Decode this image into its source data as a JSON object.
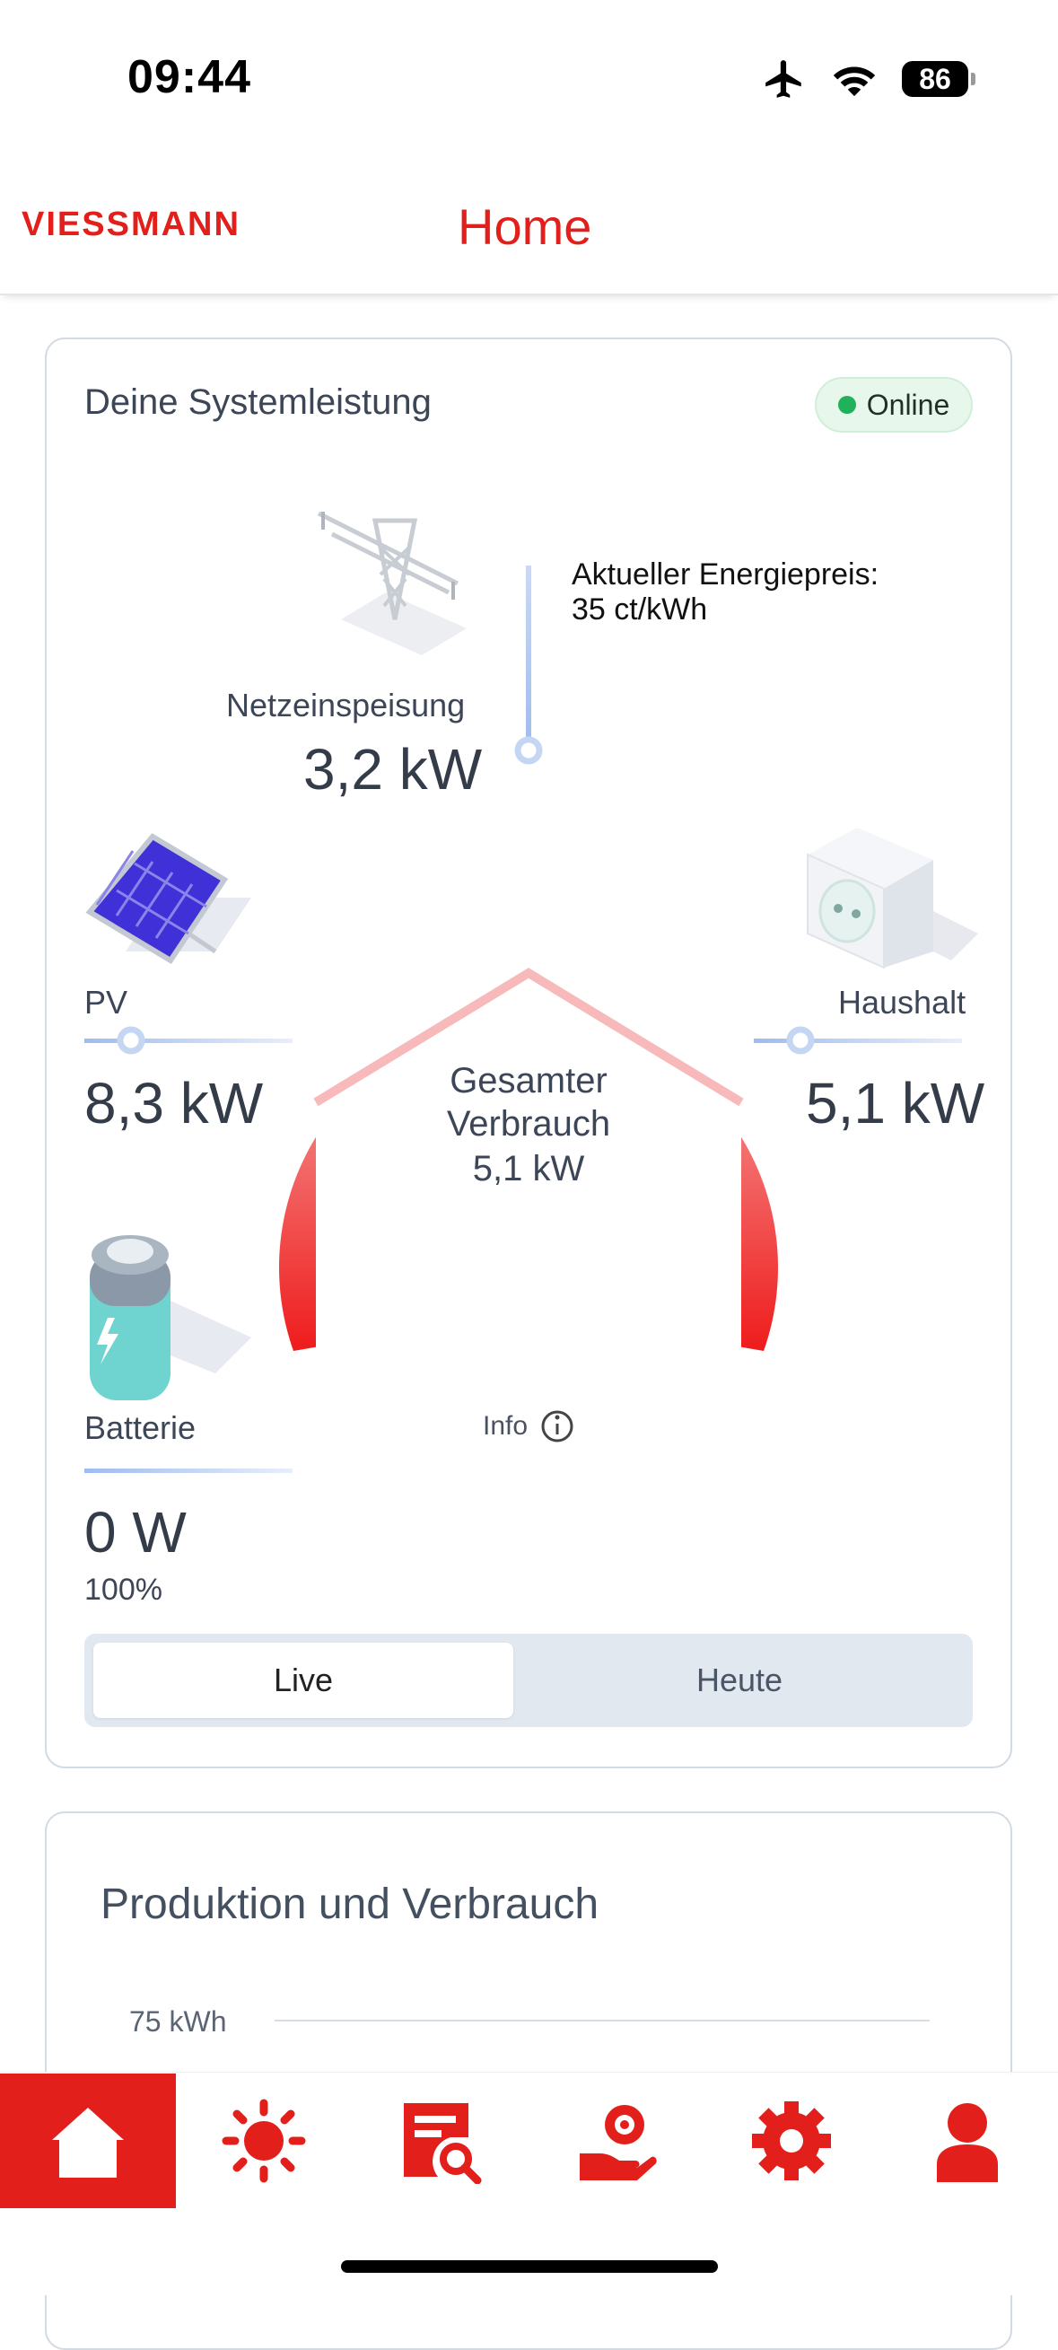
{
  "status": {
    "time": "09:44",
    "battery": "86"
  },
  "header": {
    "brand": "VIESSMANN",
    "title": "Home"
  },
  "system": {
    "title": "Deine Systemleistung",
    "status_badge": "Online",
    "grid": {
      "label": "Netzeinspeisung",
      "value": "3,2 kW",
      "price_line1": "Aktueller Energiepreis:",
      "price_line2": "35 ct/kWh"
    },
    "pv": {
      "label": "PV",
      "value": "8,3 kW"
    },
    "household": {
      "label": "Haushalt",
      "value": "5,1 kW"
    },
    "total": {
      "line1": "Gesamter",
      "line2": "Verbrauch",
      "value": "5,1 kW"
    },
    "battery": {
      "label": "Batterie",
      "value": "0 W",
      "soc": "100%"
    },
    "info": "Info",
    "tabs": {
      "live": "Live",
      "today": "Heute"
    }
  },
  "production": {
    "title": "Produktion und Verbrauch",
    "axis_label": "75 kWh"
  },
  "colors": {
    "brand_red": "#e21f1a",
    "online_green": "#1fb25a",
    "flow_blue": "#a9c4f2"
  },
  "nav": {
    "items": [
      "home-icon",
      "sun-icon",
      "report-search-icon",
      "service-hand-icon",
      "gear-icon",
      "user-icon"
    ]
  }
}
